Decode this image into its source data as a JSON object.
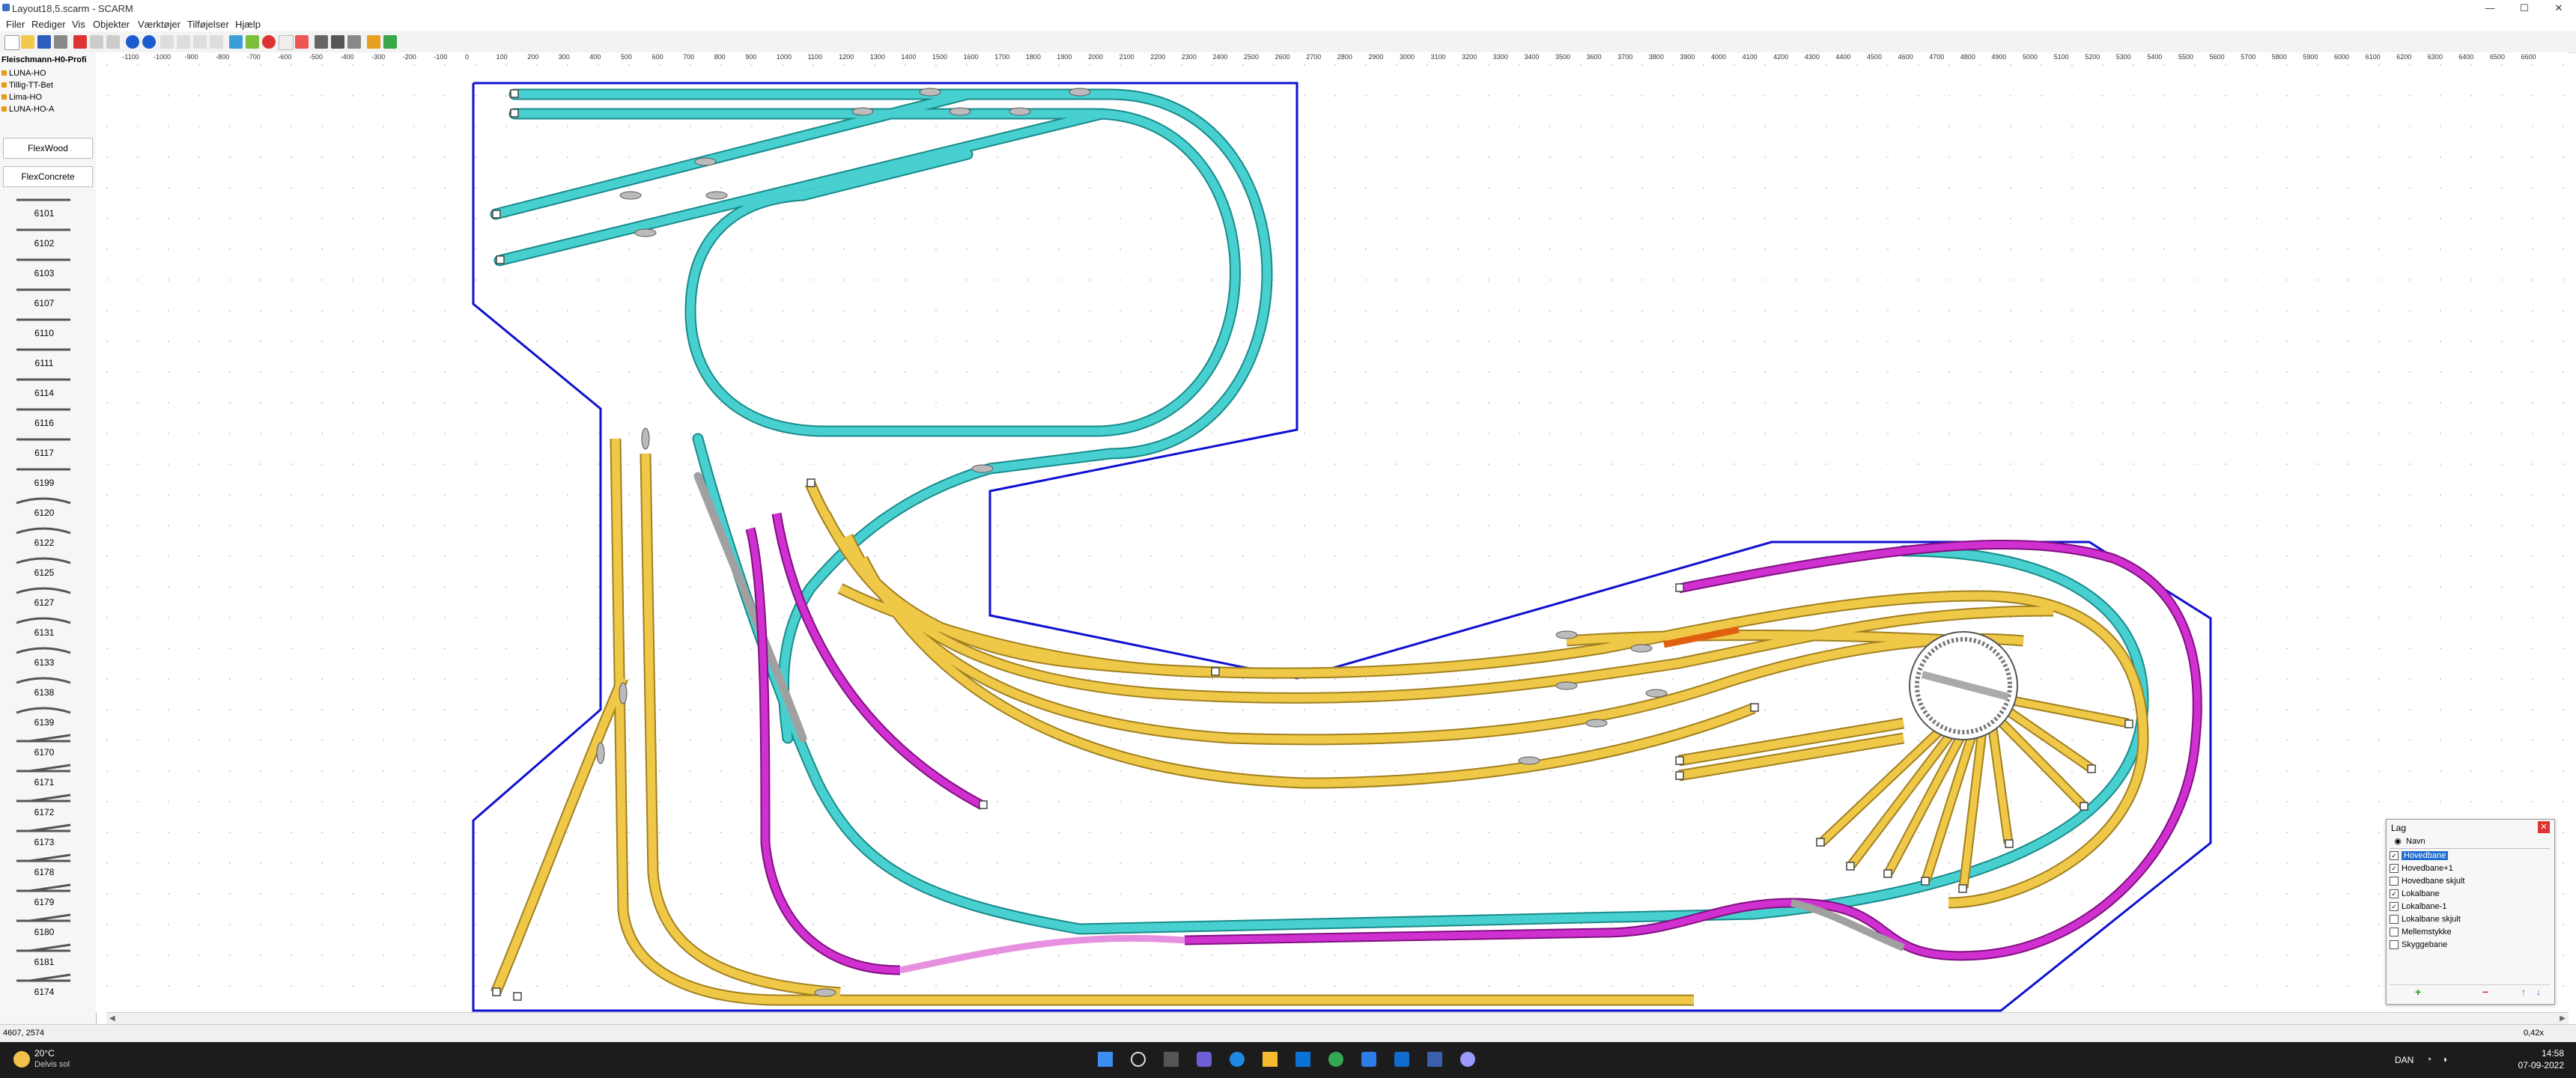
{
  "window": {
    "title": "Layout18,5.scarm - SCARM",
    "minimize": "—",
    "maximize": "☐",
    "close": "✕"
  },
  "menu": [
    "Filer",
    "Rediger",
    "Vis",
    "Objekter",
    "Værktøjer",
    "Tilføjelser",
    "Hjælp"
  ],
  "library": {
    "header": "Fleischmann-H0-Profi",
    "sets": [
      "LUNA-HO",
      "Tillig-TT-Bet",
      "Lima-HO",
      "LUNA-HO-A"
    ],
    "flex": [
      "FlexWood",
      "FlexConcrete"
    ],
    "parts": [
      "6101",
      "6102",
      "6103",
      "6107",
      "6110",
      "6111",
      "6114",
      "6116",
      "6117",
      "6199",
      "6120",
      "6122",
      "6125",
      "6127",
      "6131",
      "6133",
      "6138",
      "6139",
      "6170",
      "6171",
      "6172",
      "6173",
      "6178",
      "6179",
      "6180",
      "6181",
      "6174"
    ]
  },
  "ruler": {
    "x_ticks": [
      "-1100",
      "-1000",
      "-900",
      "-800",
      "-700",
      "-600",
      "-500",
      "-400",
      "-300",
      "-200",
      "-100",
      "0",
      "100",
      "200",
      "300",
      "400",
      "500",
      "600",
      "700",
      "800",
      "900",
      "1000",
      "1100",
      "1200",
      "1300",
      "1400",
      "1500",
      "1600",
      "1700",
      "1800",
      "1900",
      "2000",
      "2100",
      "2200",
      "2300",
      "2400",
      "2500",
      "2600",
      "2700",
      "2800",
      "2900",
      "3000",
      "3100",
      "3200",
      "3300",
      "3400",
      "3500",
      "3600",
      "3700",
      "3800",
      "3900",
      "4000",
      "4100",
      "4200",
      "4300",
      "4400",
      "4500",
      "4600",
      "4700",
      "4800",
      "4900",
      "5000",
      "5100",
      "5200",
      "5300",
      "5400",
      "5500",
      "5600",
      "5700",
      "5800",
      "5900",
      "6000",
      "6100",
      "6200",
      "6300",
      "6400",
      "6500",
      "6600"
    ],
    "unit": "mm"
  },
  "layers_panel": {
    "title": "Lag",
    "column": "Navn",
    "layers": [
      {
        "name": "Hovedbane",
        "checked": true,
        "selected": true
      },
      {
        "name": "Hovedbane+1",
        "checked": true,
        "selected": false
      },
      {
        "name": "Hovedbane skjult",
        "checked": false,
        "selected": false
      },
      {
        "name": "Lokalbane",
        "checked": true,
        "selected": false
      },
      {
        "name": "Lokalbane-1",
        "checked": true,
        "selected": false
      },
      {
        "name": "Lokalbane skjult",
        "checked": false,
        "selected": false
      },
      {
        "name": "Mellemstykke",
        "checked": false,
        "selected": false
      },
      {
        "name": "Skyggebane",
        "checked": false,
        "selected": false
      }
    ],
    "add": "+",
    "remove": "−",
    "up": "↑",
    "down": "↓"
  },
  "status": {
    "coords": "4607, 2574",
    "zoom": "0,42x"
  },
  "taskbar": {
    "weather_temp": "20°C",
    "weather_text": "Delvis sol",
    "lang": "DAN",
    "time": "14:58",
    "date": "07-09-2022"
  },
  "colors": {
    "board": "#1010d0",
    "main_track": "#40c8c8",
    "local_track": "#e8c040",
    "lower_track": "#c020c0",
    "hidden_track": "#e890e0"
  }
}
